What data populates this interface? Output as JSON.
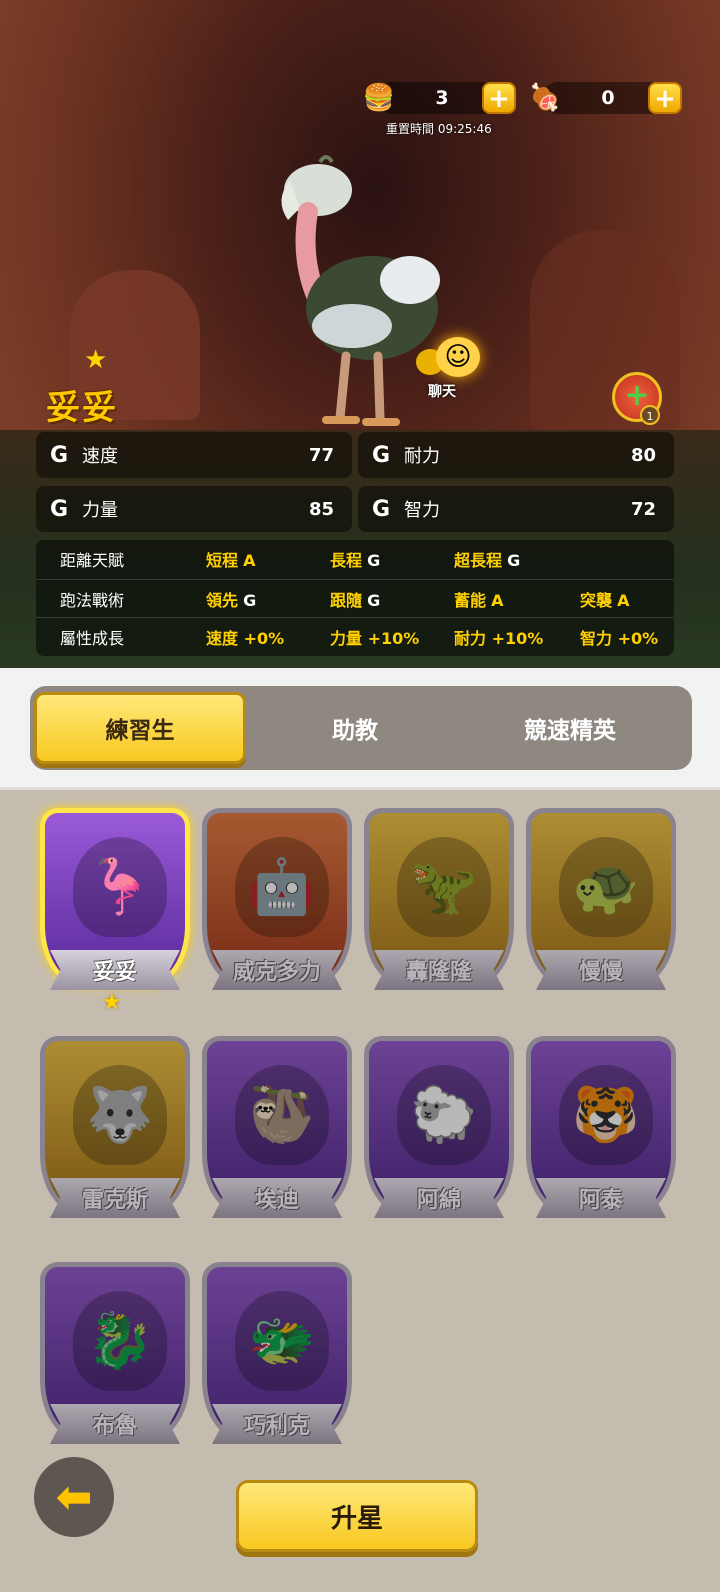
{
  "resources": {
    "food": {
      "icon": "burger-icon",
      "count": "3"
    },
    "meat": {
      "icon": "meat-icon",
      "count": "0"
    },
    "reset_time": "重置時間 09:25:46"
  },
  "character": {
    "name": "妥妥",
    "stars": 1,
    "chat_label": "聊天",
    "heal_badge": "1"
  },
  "stats": [
    {
      "grade": "G",
      "label": "速度",
      "value": "77"
    },
    {
      "grade": "G",
      "label": "耐力",
      "value": "80"
    },
    {
      "grade": "G",
      "label": "力量",
      "value": "85"
    },
    {
      "grade": "G",
      "label": "智力",
      "value": "72"
    }
  ],
  "details": {
    "distance": {
      "label": "距離天賦",
      "items": [
        {
          "name": "短程",
          "grade": "A"
        },
        {
          "name": "長程",
          "grade": "G"
        },
        {
          "name": "超長程",
          "grade": "G"
        }
      ]
    },
    "tactics": {
      "label": "跑法戰術",
      "items": [
        {
          "name": "領先",
          "grade": "G"
        },
        {
          "name": "跟隨",
          "grade": "G"
        },
        {
          "name": "蓄能",
          "grade": "A"
        },
        {
          "name": "突襲",
          "grade": "A"
        }
      ]
    },
    "growth": {
      "label": "屬性成長",
      "items": [
        {
          "name": "速度 +0%"
        },
        {
          "name": "力量 +10%"
        },
        {
          "name": "耐力 +10%"
        },
        {
          "name": "智力 +0%"
        }
      ]
    }
  },
  "tabs": [
    {
      "label": "練習生",
      "active": true
    },
    {
      "label": "助教",
      "active": false
    },
    {
      "label": "競速精英",
      "active": false
    }
  ],
  "cards": [
    {
      "name": "妥妥",
      "frame": "purple",
      "icon": "ostrich-icon",
      "selected": true
    },
    {
      "name": "威克多力",
      "frame": "orange",
      "icon": "robot-dino-icon",
      "selected": false
    },
    {
      "name": "轟隆隆",
      "frame": "gold",
      "icon": "black-dino-icon",
      "selected": false
    },
    {
      "name": "慢慢",
      "frame": "gold",
      "icon": "turtle-icon",
      "selected": false
    },
    {
      "name": "雷克斯",
      "frame": "gold",
      "icon": "wolf-icon",
      "selected": false
    },
    {
      "name": "埃迪",
      "frame": "purple",
      "icon": "sloth-icon",
      "selected": false
    },
    {
      "name": "阿綿",
      "frame": "purple",
      "icon": "sheep-icon",
      "selected": false
    },
    {
      "name": "阿泰",
      "frame": "purple",
      "icon": "tiger-icon",
      "selected": false
    },
    {
      "name": "布魯",
      "frame": "purple",
      "icon": "red-dragon-icon",
      "selected": false
    },
    {
      "name": "巧利克",
      "frame": "purple",
      "icon": "white-dragon-icon",
      "selected": false
    }
  ],
  "buttons": {
    "back": "back-arrow-icon",
    "upgrade": "升星"
  }
}
